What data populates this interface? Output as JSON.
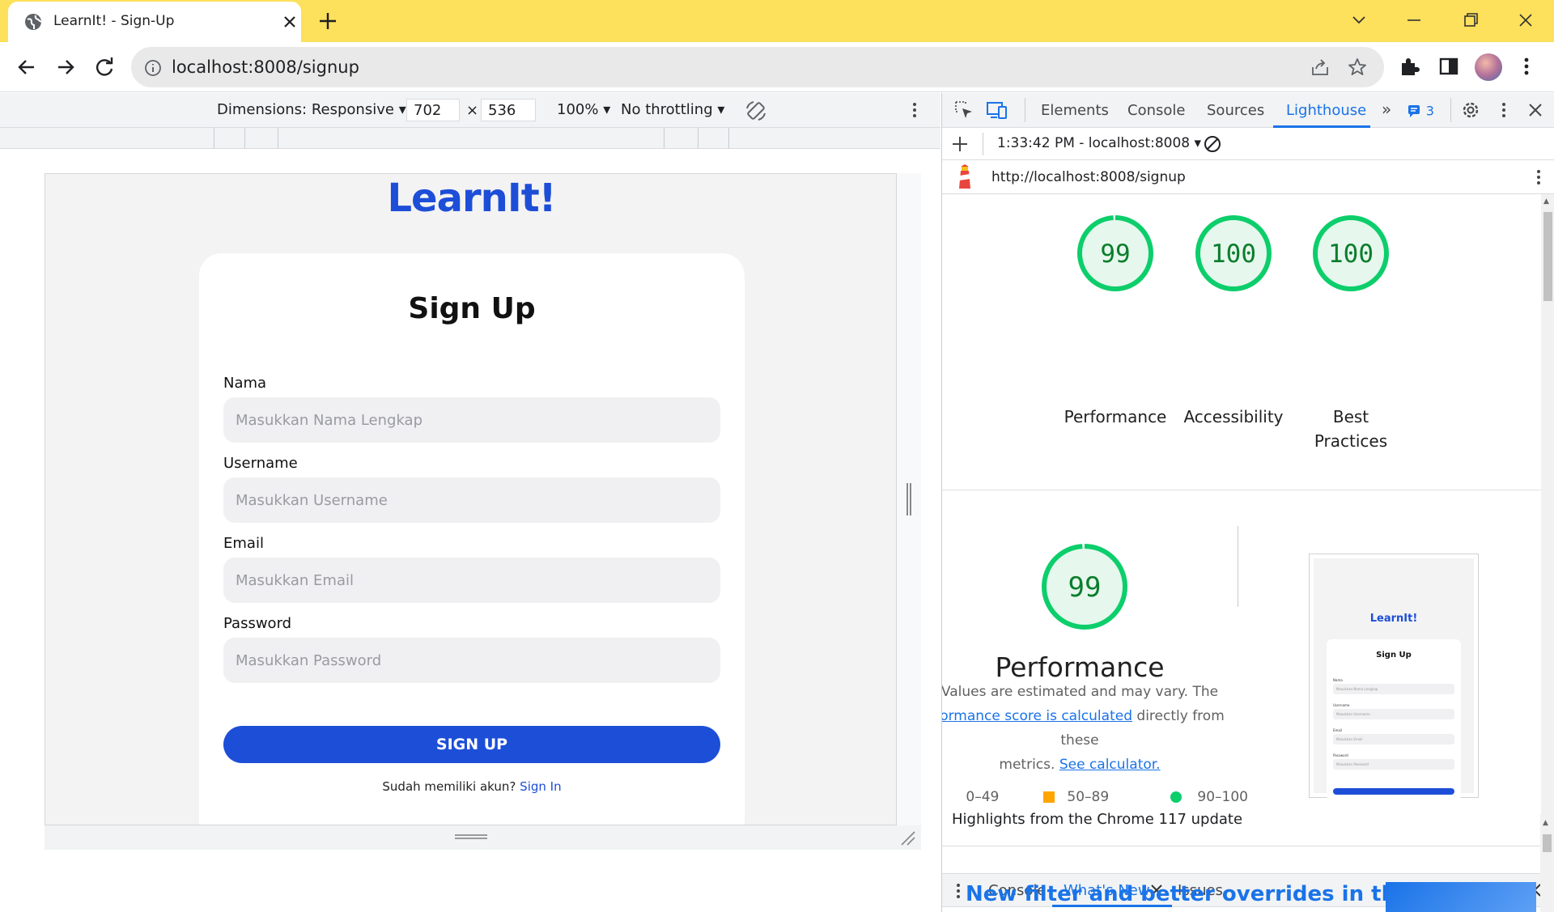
{
  "browser": {
    "tab_title": "LearnIt! - Sign-Up",
    "url": "localhost:8008/signup"
  },
  "device_toolbar": {
    "dimensions_label": "Dimensions: Responsive",
    "width": "702",
    "height": "536",
    "times": "×",
    "zoom": "100%",
    "throttling": "No throttling"
  },
  "page": {
    "logo": "LearnIt!",
    "form_title": "Sign Up",
    "fields": [
      {
        "label": "Nama",
        "placeholder": "Masukkan Nama Lengkap"
      },
      {
        "label": "Username",
        "placeholder": "Masukkan Username"
      },
      {
        "label": "Email",
        "placeholder": "Masukkan Email"
      },
      {
        "label": "Password",
        "placeholder": "Masukkan Password"
      }
    ],
    "submit_label": "SIGN UP",
    "signin_prompt": "Sudah memiliki akun?",
    "signin_link": "Sign In"
  },
  "devtools": {
    "tabs": [
      "Elements",
      "Console",
      "Sources",
      "Lighthouse"
    ],
    "active_tab": "Lighthouse",
    "issues_count": "3",
    "report_time": "1:33:42 PM - localhost:8008",
    "report_url": "http://localhost:8008/signup",
    "scores": [
      {
        "value": 99,
        "label": "Performance"
      },
      {
        "value": 100,
        "label": "Accessibility"
      },
      {
        "value": 100,
        "label": "Best Practices"
      }
    ],
    "performance": {
      "score": 99,
      "title": "Performance",
      "desc_1": "Values are estimated and may vary. The",
      "desc_link": "formance score is calculated",
      "desc_2": "directly from these",
      "desc_3": "metrics.",
      "desc_link_2": "See calculator."
    },
    "legend": [
      "0–49",
      "50–89",
      "90–100"
    ],
    "thumbnail": {
      "logo": "LearnIt!",
      "title": "Sign Up",
      "labels": [
        "Nama",
        "Username",
        "Email",
        "Password"
      ],
      "placeholders": [
        "Masukkan Nama Lengkap",
        "Masukkan Username",
        "Masukkan Email",
        "Masukkan Password"
      ]
    },
    "drawer_tabs": [
      "Console",
      "What's New",
      "Issues"
    ],
    "drawer_active": "What's New",
    "whatsnew_headline": "Highlights from the Chrome 117 update",
    "whatsnew_title": "New filter and better overrides in the"
  },
  "colors": {
    "chrome_tab_strip": "#fde05b",
    "brand_blue": "#1d4ed8",
    "score_green": "#0cce6b",
    "score_orange": "#ffa400",
    "link_blue": "#1a73e8"
  }
}
